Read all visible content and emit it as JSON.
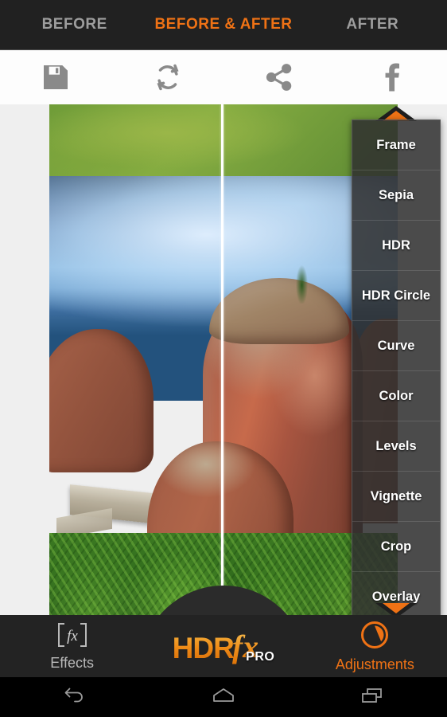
{
  "tabs": [
    {
      "label": "BEFORE",
      "active": false
    },
    {
      "label": "BEFORE & AFTER",
      "active": true
    },
    {
      "label": "AFTER",
      "active": false
    }
  ],
  "toolbar": {
    "save_icon": "save-icon",
    "reset_icon": "refresh-icon",
    "share_icon": "share-icon",
    "facebook_icon": "facebook-icon"
  },
  "effects_menu": {
    "scroll_up_icon": "caret-up-icon",
    "scroll_down_icon": "caret-down-icon",
    "items": [
      {
        "label": "Frame"
      },
      {
        "label": "Sepia"
      },
      {
        "label": "HDR"
      },
      {
        "label": "HDR Circle"
      },
      {
        "label": "Curve"
      },
      {
        "label": "Color"
      },
      {
        "label": "Levels"
      },
      {
        "label": "Vignette"
      },
      {
        "label": "Crop"
      },
      {
        "label": "Overlay"
      }
    ]
  },
  "bottom_bar": {
    "effects_label": "Effects",
    "effects_icon": "fx-icon",
    "adjustments_label": "Adjustments",
    "adjustments_icon": "contrast-circle-icon",
    "logo_hdr": "HDR",
    "logo_fx": "fx",
    "logo_pro": "PRO"
  },
  "navbar": {
    "back_icon": "back-arrow-icon",
    "home_icon": "home-icon",
    "recents_icon": "recents-icon"
  },
  "colors": {
    "accent": "#ef7215",
    "tab_inactive": "#9d9d9d",
    "tabbar_bg": "#212121",
    "toolbar_bg": "#fdfdfd",
    "bottombar_bg": "#232323",
    "stage_bg": "#EFEFEF",
    "menu_bg": "#303030"
  }
}
